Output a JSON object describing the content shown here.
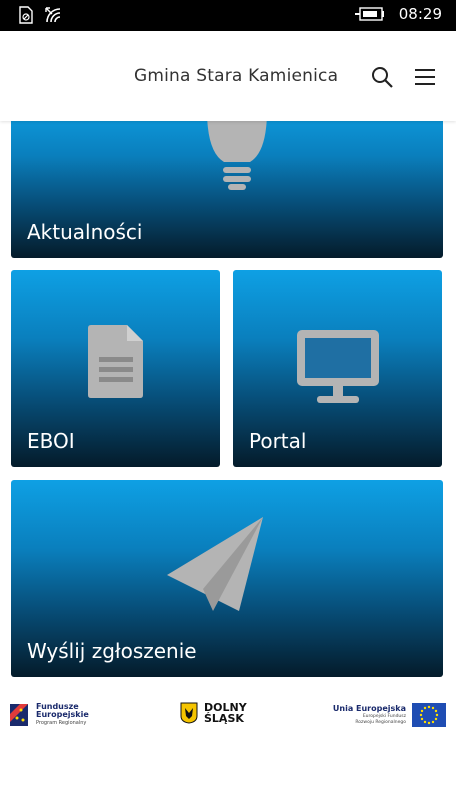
{
  "status_bar": {
    "time": "08:29",
    "icons": [
      "sim-no-signal-icon",
      "wifi-icon",
      "battery-charging-icon"
    ]
  },
  "header": {
    "title": "Gmina Stara Kamienica",
    "search_icon": "search-icon",
    "menu_icon": "hamburger-menu-icon"
  },
  "tiles": [
    {
      "label": "Aktualności",
      "icon": "lightbulb-icon"
    },
    {
      "label": "EBOI",
      "icon": "document-icon"
    },
    {
      "label": "Portal",
      "icon": "monitor-icon"
    },
    {
      "label": "Wyślij zgłoszenie",
      "icon": "paper-plane-icon"
    }
  ],
  "footer": {
    "fe_title_1": "Fundusze",
    "fe_title_2": "Europejskie",
    "fe_subtitle": "Program Regionalny",
    "ds_line_1": "DOLNY",
    "ds_line_2": "ŚLĄSK",
    "eu_title": "Unia Europejska",
    "eu_subtitle_1": "Europejski Fundusz",
    "eu_subtitle_2": "Rozwoju Regionalnego"
  },
  "colors": {
    "tile_top": "#0ea0e4",
    "tile_bottom": "#041b2a",
    "icon_gray": "#b4b4b4",
    "eu_blue": "#1f4db3",
    "eu_star": "#ffdd00"
  }
}
